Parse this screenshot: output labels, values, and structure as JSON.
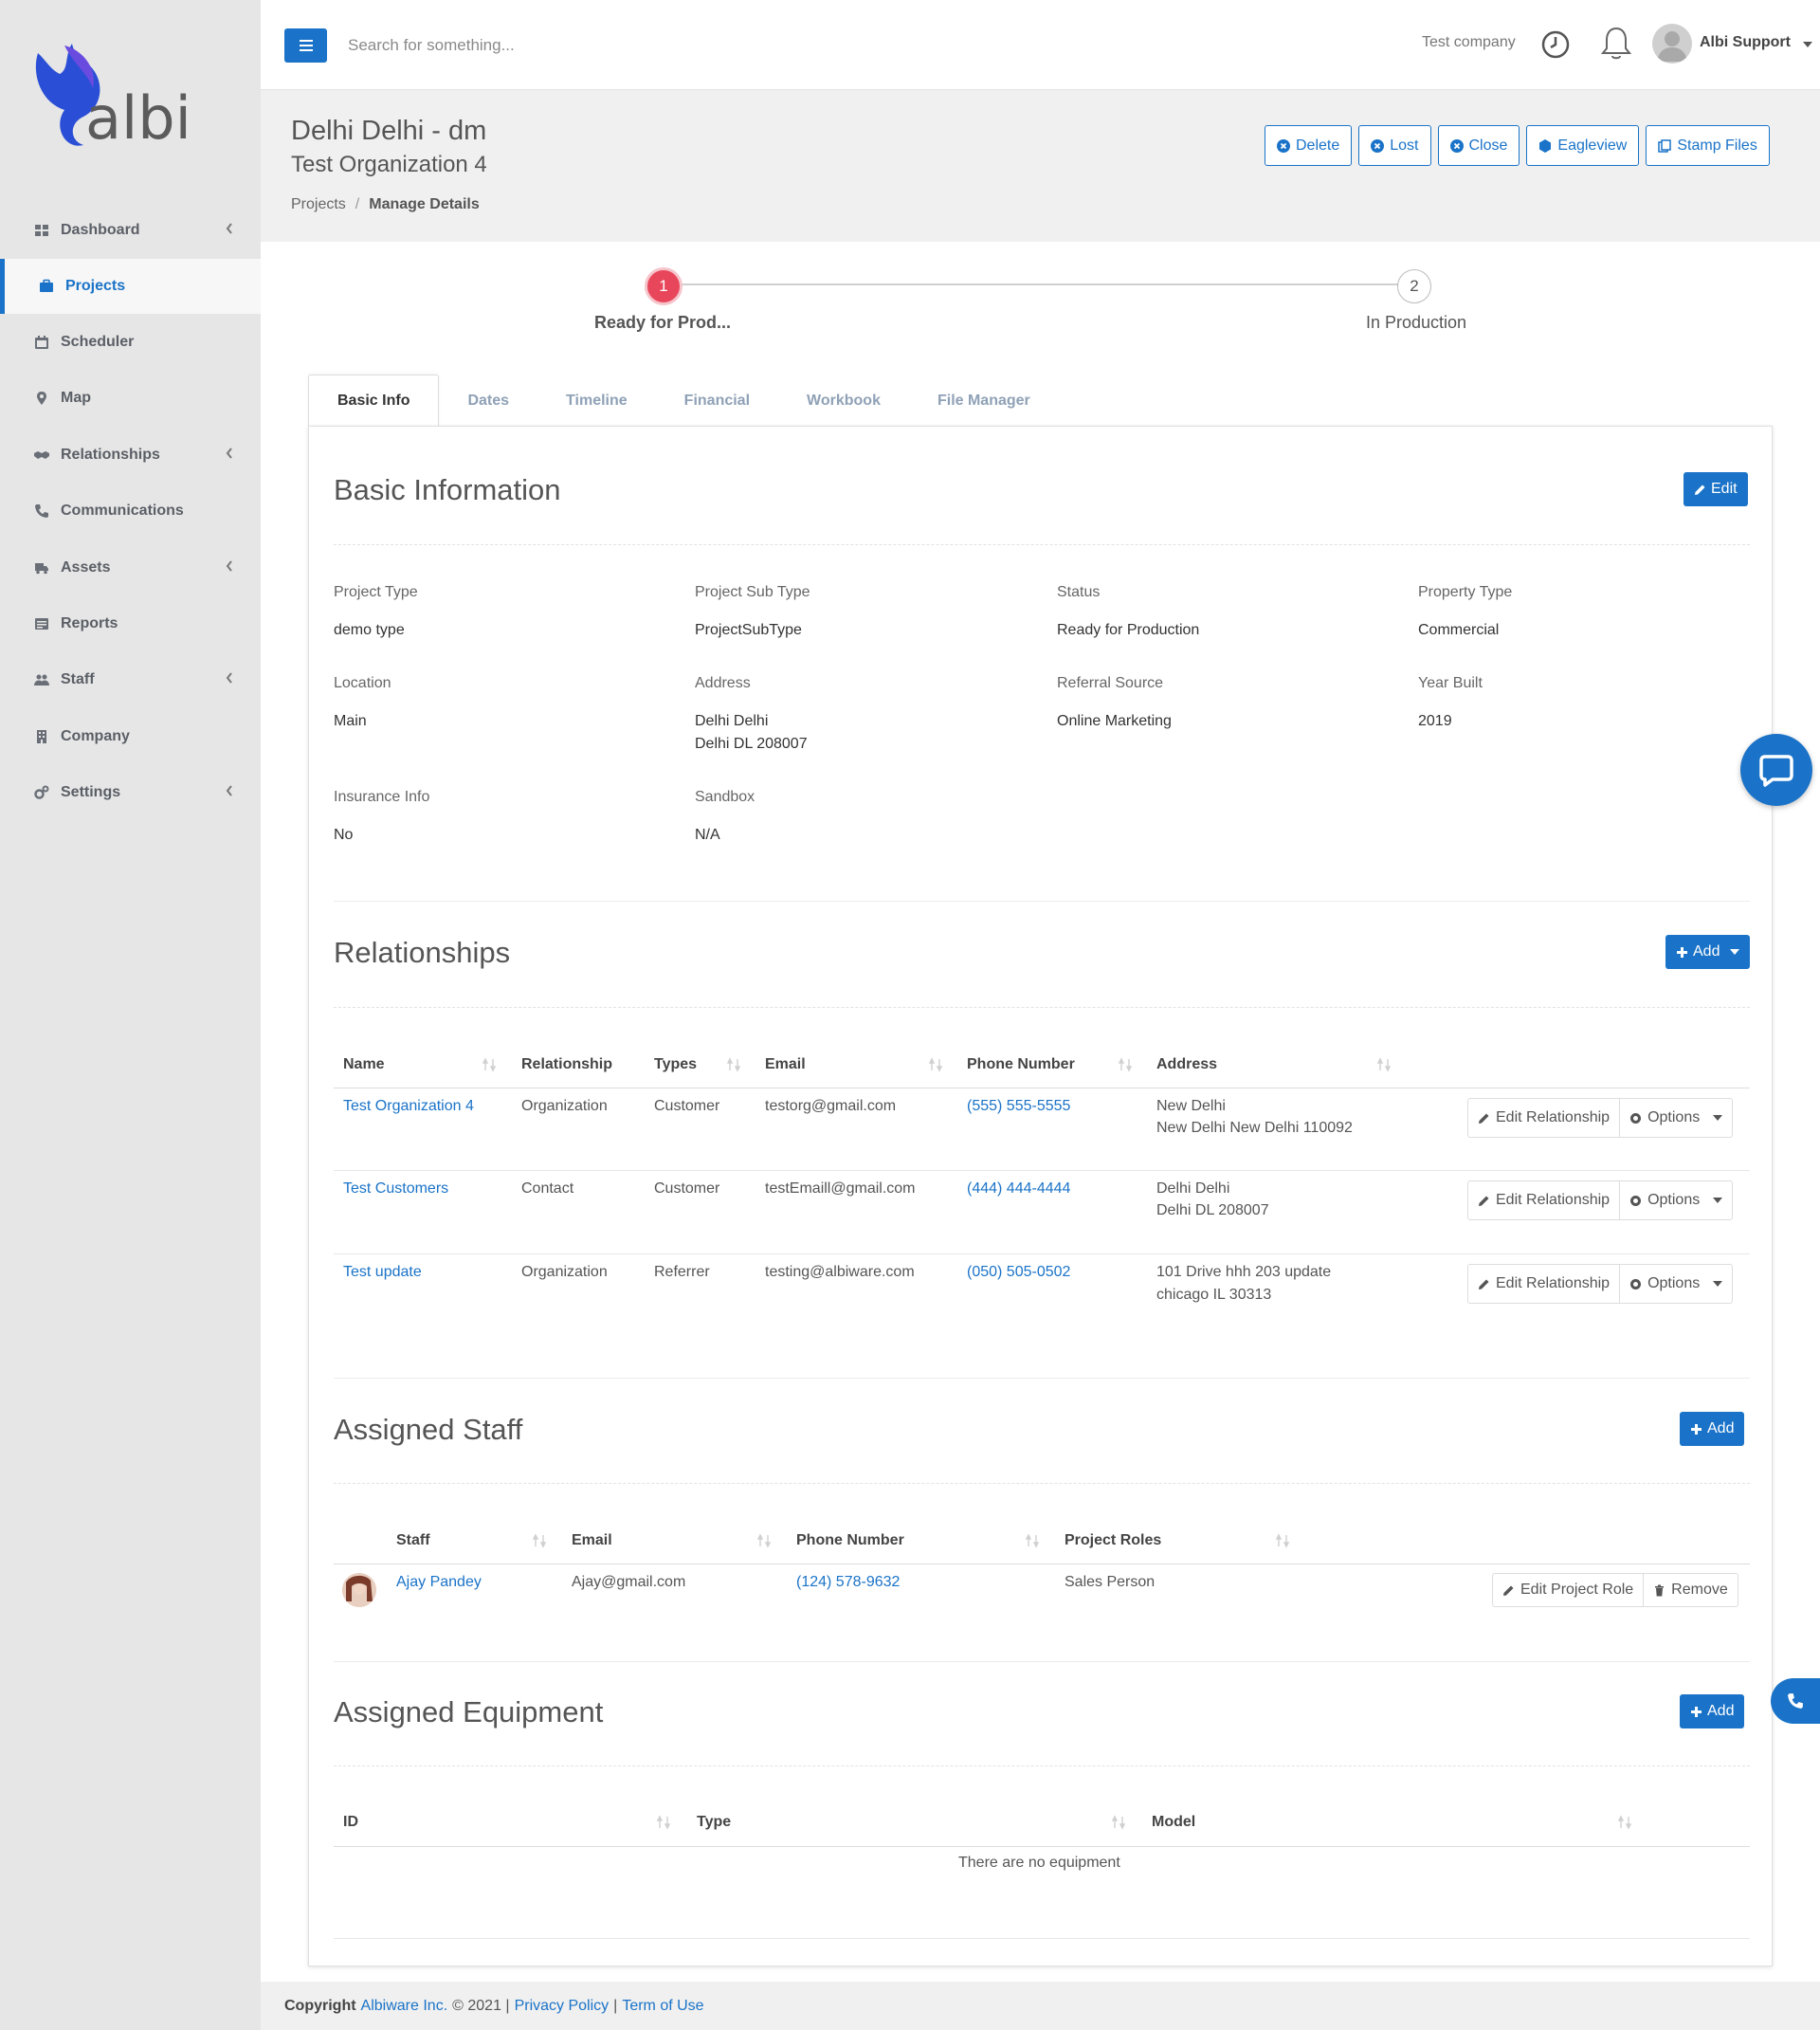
{
  "app": {
    "brand": "albi",
    "accent": "#1a73c8",
    "danger": "#e8475b"
  },
  "sidebar": {
    "items": [
      {
        "label": "Dashboard",
        "icon": "dashboard-icon",
        "chevron": true
      },
      {
        "label": "Projects",
        "icon": "briefcase-icon",
        "active": true
      },
      {
        "label": "Scheduler",
        "icon": "calendar-icon"
      },
      {
        "label": "Map",
        "icon": "map-pin-icon"
      },
      {
        "label": "Relationships",
        "icon": "handshake-icon",
        "chevron": true
      },
      {
        "label": "Communications",
        "icon": "phone-icon"
      },
      {
        "label": "Assets",
        "icon": "truck-icon",
        "chevron": true
      },
      {
        "label": "Reports",
        "icon": "report-icon"
      },
      {
        "label": "Staff",
        "icon": "users-icon",
        "chevron": true
      },
      {
        "label": "Company",
        "icon": "building-icon"
      },
      {
        "label": "Settings",
        "icon": "cogs-icon",
        "chevron": true
      }
    ]
  },
  "topbar": {
    "search_placeholder": "Search for something...",
    "company": "Test company",
    "user": "Albi Support"
  },
  "header": {
    "title": "Delhi Delhi - dm",
    "organization": "Test Organization 4",
    "breadcrumb": [
      "Projects",
      "Manage Details"
    ],
    "actions": [
      {
        "label": "Delete",
        "icon": "times-circle-icon"
      },
      {
        "label": "Lost",
        "icon": "times-circle-icon"
      },
      {
        "label": "Close",
        "icon": "times-circle-icon"
      },
      {
        "label": "Eagleview",
        "icon": "eagleview-icon"
      },
      {
        "label": "Stamp Files",
        "icon": "copy-icon"
      }
    ]
  },
  "steps": [
    {
      "number": "1",
      "label": "Ready for Prod..."
    },
    {
      "number": "2",
      "label": "In Production"
    }
  ],
  "tabs": [
    "Basic Info",
    "Dates",
    "Timeline",
    "Financial",
    "Workbook",
    "File Manager"
  ],
  "basic_info": {
    "title": "Basic Information",
    "edit_label": "Edit",
    "fields": [
      {
        "label": "Project Type",
        "value": "demo type"
      },
      {
        "label": "Project Sub Type",
        "value": "ProjectSubType"
      },
      {
        "label": "Status",
        "value": "Ready for Production"
      },
      {
        "label": "Property Type",
        "value": "Commercial"
      },
      {
        "label": "Location",
        "value": "Main"
      },
      {
        "label": "Address",
        "value": "Delhi Delhi",
        "value2": "Delhi DL 208007"
      },
      {
        "label": "Referral Source",
        "value": "Online Marketing"
      },
      {
        "label": "Year Built",
        "value": "2019"
      },
      {
        "label": "Insurance Info",
        "value": "No"
      },
      {
        "label": "Sandbox",
        "value": "N/A"
      }
    ]
  },
  "relationships": {
    "title": "Relationships",
    "add_label": "Add",
    "columns": [
      "Name",
      "Relationship",
      "Types",
      "Email",
      "Phone Number",
      "Address"
    ],
    "edit_label": "Edit Relationship",
    "options_label": "Options",
    "rows": [
      {
        "name": "Test Organization 4",
        "relationship": "Organization",
        "types": "Customer",
        "email": "testorg@gmail.com",
        "phone": "(555) 555-5555",
        "address1": "New Delhi",
        "address2": "New Delhi New Delhi 110092"
      },
      {
        "name": "Test Customers",
        "relationship": "Contact",
        "types": "Customer",
        "email": "testEmaill@gmail.com",
        "phone": "(444) 444-4444",
        "address1": "Delhi Delhi",
        "address2": "Delhi DL 208007"
      },
      {
        "name": "Test update",
        "relationship": "Organization",
        "types": "Referrer",
        "email": "testing@albiware.com",
        "phone": "(050) 505-0502",
        "address1": "101 Drive hhh 203 update",
        "address2": "chicago IL 30313"
      }
    ]
  },
  "staff": {
    "title": "Assigned Staff",
    "add_label": "Add",
    "columns": [
      "Staff",
      "Email",
      "Phone Number",
      "Project Roles"
    ],
    "edit_label": "Edit Project Role",
    "remove_label": "Remove",
    "rows": [
      {
        "name": "Ajay Pandey",
        "email": "Ajay@gmail.com",
        "phone": "(124) 578-9632",
        "role": "Sales Person"
      }
    ]
  },
  "equipment": {
    "title": "Assigned Equipment",
    "add_label": "Add",
    "columns": [
      "ID",
      "Type",
      "Model"
    ],
    "empty": "There are no equipment"
  },
  "footer": {
    "copyright": "Copyright",
    "company": "Albiware Inc.",
    "year": "© 2021 |",
    "privacy": "Privacy Policy",
    "sep": "|",
    "terms": "Term of Use"
  }
}
